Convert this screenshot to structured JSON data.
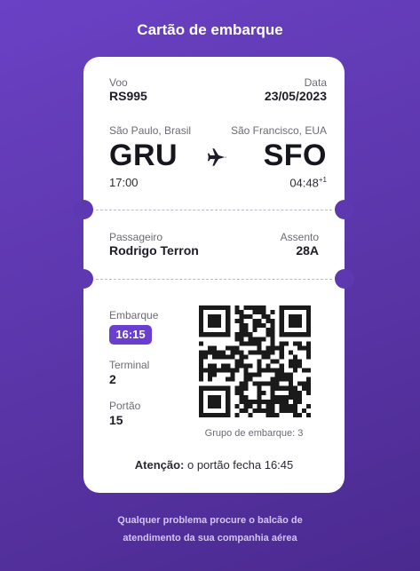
{
  "header": {
    "title": "Cartão de embarque"
  },
  "flight": {
    "voo_label": "Voo",
    "voo_value": "RS995",
    "data_label": "Data",
    "data_value": "23/05/2023"
  },
  "route": {
    "origin_city": "São Paulo, Brasil",
    "origin_code": "GRU",
    "origin_time": "17:00",
    "destination_city": "São Francisco, EUA",
    "destination_code": "SFO",
    "destination_time": "04:48",
    "destination_time_suffix": "+1",
    "icon": "airplane-icon"
  },
  "passenger": {
    "label": "Passageiro",
    "name": "Rodrigo Terron",
    "seat_label": "Assento",
    "seat": "28A"
  },
  "boarding": {
    "embarque_label": "Embarque",
    "embarque_time": "16:15",
    "terminal_label": "Terminal",
    "terminal": "2",
    "portao_label": "Portão",
    "portao": "15",
    "group_caption": "Grupo de embarque: 3"
  },
  "notice": {
    "bold": "Atenção:",
    "text": " o portão fecha 16:45"
  },
  "footer": {
    "line1": "Qualquer problema procure o balcão de",
    "line2": "atendimento da sua companhia aérea"
  },
  "colors": {
    "background_top": "#6a41c4",
    "background_bottom": "#4b2a8f",
    "badge": "#6a3fcf"
  }
}
